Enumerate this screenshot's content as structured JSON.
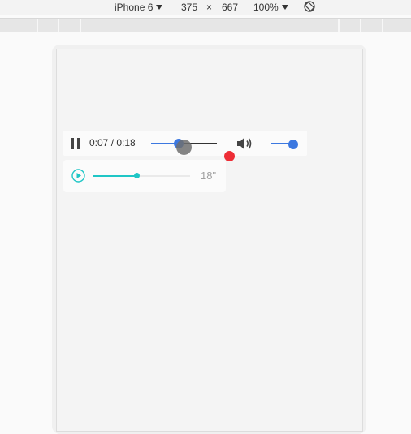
{
  "toolbar": {
    "device": "iPhone 6",
    "width": "375",
    "times": "×",
    "height": "667",
    "zoom": "100%"
  },
  "video_player": {
    "time": "0:07 / 0:18",
    "progress_fraction": 0.42,
    "volume_fraction": 1.0,
    "accent_color": "#3c78e0"
  },
  "audio_player": {
    "duration": "18\"",
    "progress_fraction": 0.45,
    "accent_color": "#1fc6c6"
  },
  "icons": {
    "pause": "pause-icon",
    "volume": "volume-icon",
    "play": "play-circle-icon",
    "rotate": "rotate-icon",
    "dropdown": "caret-down-icon"
  }
}
